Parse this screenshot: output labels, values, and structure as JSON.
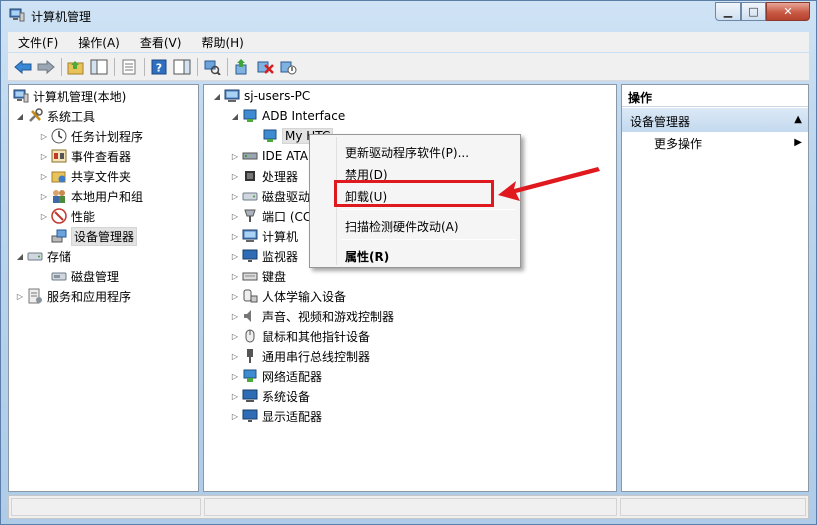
{
  "window": {
    "title": "计算机管理"
  },
  "menubar": [
    "文件(F)",
    "操作(A)",
    "查看(V)",
    "帮助(H)"
  ],
  "left_tree": [
    {
      "label": "计算机管理(本地)",
      "icon": "computer-management-icon",
      "expander": "",
      "depth": 0
    },
    {
      "label": "系统工具",
      "icon": "tools-icon",
      "expander": "◢",
      "depth": 1
    },
    {
      "label": "任务计划程序",
      "icon": "clock-icon",
      "expander": "▷",
      "depth": 2
    },
    {
      "label": "事件查看器",
      "icon": "event-viewer-icon",
      "expander": "▷",
      "depth": 2
    },
    {
      "label": "共享文件夹",
      "icon": "shared-folder-icon",
      "expander": "▷",
      "depth": 2
    },
    {
      "label": "本地用户和组",
      "icon": "users-icon",
      "expander": "▷",
      "depth": 2
    },
    {
      "label": "性能",
      "icon": "performance-icon",
      "expander": "▷",
      "depth": 2
    },
    {
      "label": "设备管理器",
      "icon": "device-manager-icon",
      "expander": "",
      "depth": 2,
      "selected": true
    },
    {
      "label": "存储",
      "icon": "storage-icon",
      "expander": "◢",
      "depth": 1
    },
    {
      "label": "磁盘管理",
      "icon": "disk-icon",
      "expander": "",
      "depth": 2
    },
    {
      "label": "服务和应用程序",
      "icon": "services-icon",
      "expander": "▷",
      "depth": 1
    }
  ],
  "device_tree": {
    "root": "sj-users-PC",
    "items": [
      {
        "label": "ADB Interface",
        "icon": "adb-icon",
        "expander": "◢",
        "depth": 1
      },
      {
        "label": "My HTC",
        "icon": "adb-device-icon",
        "expander": "",
        "depth": 2,
        "selected": true
      },
      {
        "label": "IDE ATA",
        "icon": "ide-icon",
        "expander": "▷",
        "depth": 1
      },
      {
        "label": "处理器",
        "icon": "cpu-icon",
        "expander": "▷",
        "depth": 1
      },
      {
        "label": "磁盘驱动",
        "icon": "disk-drive-icon",
        "expander": "▷",
        "depth": 1
      },
      {
        "label": "端口 (CC",
        "icon": "port-icon",
        "expander": "▷",
        "depth": 1
      },
      {
        "label": "计算机",
        "icon": "computer-icon",
        "expander": "▷",
        "depth": 1
      },
      {
        "label": "监视器",
        "icon": "monitor-icon",
        "expander": "▷",
        "depth": 1
      },
      {
        "label": "键盘",
        "icon": "keyboard-icon",
        "expander": "▷",
        "depth": 1
      },
      {
        "label": "人体学输入设备",
        "icon": "hid-icon",
        "expander": "▷",
        "depth": 1
      },
      {
        "label": "声音、视频和游戏控制器",
        "icon": "sound-icon",
        "expander": "▷",
        "depth": 1
      },
      {
        "label": "鼠标和其他指针设备",
        "icon": "mouse-icon",
        "expander": "▷",
        "depth": 1
      },
      {
        "label": "通用串行总线控制器",
        "icon": "usb-icon",
        "expander": "▷",
        "depth": 1
      },
      {
        "label": "网络适配器",
        "icon": "network-icon",
        "expander": "▷",
        "depth": 1
      },
      {
        "label": "系统设备",
        "icon": "system-device-icon",
        "expander": "▷",
        "depth": 1
      },
      {
        "label": "显示适配器",
        "icon": "display-adapter-icon",
        "expander": "▷",
        "depth": 1
      }
    ]
  },
  "context_menu": {
    "items": [
      "更新驱动程序软件(P)...",
      "禁用(D)",
      "卸载(U)",
      "扫描检测硬件改动(A)",
      "属性(R)"
    ],
    "highlighted": "卸载(U)"
  },
  "actions_pane": {
    "header": "操作",
    "section": "设备管理器",
    "more": "更多操作"
  },
  "colors": {
    "highlight": "#e0191e",
    "title_bg": "#bcd6ee"
  }
}
